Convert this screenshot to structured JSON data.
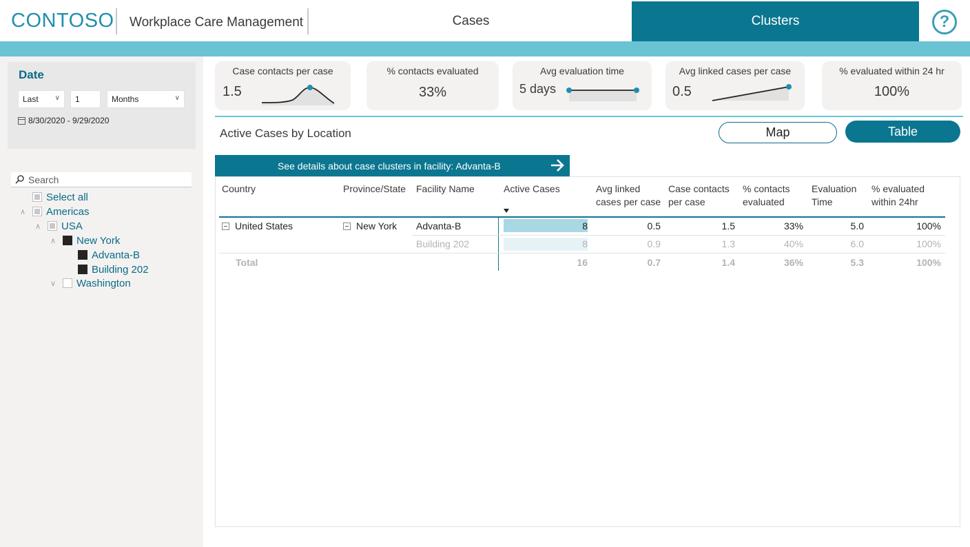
{
  "header": {
    "logo": "CONTOSO",
    "app_title": "Workplace Care Management",
    "tabs": [
      {
        "label": "Cases",
        "active": false
      },
      {
        "label": "Clusters",
        "active": true
      }
    ],
    "help_glyph": "?"
  },
  "colors": {
    "accent": "#0b7690",
    "accent_light": "#6ac3d3",
    "databar": "#a8d8e3"
  },
  "filters": {
    "date": {
      "title": "Date",
      "period_mode": "Last",
      "period_count": "1",
      "period_unit": "Months",
      "range_text": "8/30/2020 - 9/29/2020"
    },
    "search_placeholder": "Search",
    "tree": [
      {
        "label": "Select all",
        "level": 0,
        "state": "partial",
        "caret": ""
      },
      {
        "label": "Americas",
        "level": 0,
        "state": "partial",
        "caret": "up"
      },
      {
        "label": "USA",
        "level": 1,
        "state": "partial",
        "caret": "up"
      },
      {
        "label": "New York",
        "level": 2,
        "state": "checked",
        "caret": "up"
      },
      {
        "label": "Advanta-B",
        "level": 3,
        "state": "checked",
        "caret": ""
      },
      {
        "label": "Building 202",
        "level": 3,
        "state": "checked",
        "caret": ""
      },
      {
        "label": "Washington",
        "level": 2,
        "state": "unchecked",
        "caret": "down"
      }
    ]
  },
  "kpis": [
    {
      "title": "Case contacts per case",
      "value": "1.5"
    },
    {
      "title": "% contacts evaluated",
      "value": "33%"
    },
    {
      "title": "Avg evaluation time",
      "value": "5 days"
    },
    {
      "title": "Avg linked cases per case",
      "value": "0.5"
    },
    {
      "title": "% evaluated within 24 hr",
      "value": "100%"
    }
  ],
  "section": {
    "title": "Active Cases by Location",
    "map_button": "Map",
    "table_button": "Table",
    "details_button": "See details about case clusters in facility: Advanta-B"
  },
  "table": {
    "headers": [
      "Country",
      "Province/State",
      "Facility Name",
      "Active Cases",
      "Avg linked cases per case",
      "Case contacts per case",
      "% contacts evaluated",
      "Evaluation Time",
      "% evaluated within 24hr"
    ],
    "header_lines": [
      [
        "Country"
      ],
      [
        "Province/State"
      ],
      [
        "Facility Name"
      ],
      [
        "Active Cases"
      ],
      [
        "Avg linked",
        "cases per case"
      ],
      [
        "Case contacts",
        "per case"
      ],
      [
        "% contacts",
        "evaluated"
      ],
      [
        "Evaluation",
        "Time"
      ],
      [
        "% evaluated",
        "within 24hr"
      ]
    ],
    "rows": [
      {
        "country": "United States",
        "state": "New York",
        "facility": "Advanta-B",
        "active": "8",
        "active_share": 1.0,
        "linked": "0.5",
        "contacts": "1.5",
        "pct_eval": "33%",
        "eval_time": "5.0",
        "pct_24": "100%"
      },
      {
        "country": "",
        "state": "",
        "facility": "Building 202",
        "active": "8",
        "active_share": 1.0,
        "linked": "0.9",
        "contacts": "1.3",
        "pct_eval": "40%",
        "eval_time": "6.0",
        "pct_24": "100%"
      }
    ],
    "total": {
      "label": "Total",
      "active": "16",
      "linked": "0.7",
      "contacts": "1.4",
      "pct_eval": "36%",
      "eval_time": "5.3",
      "pct_24": "100%"
    }
  }
}
